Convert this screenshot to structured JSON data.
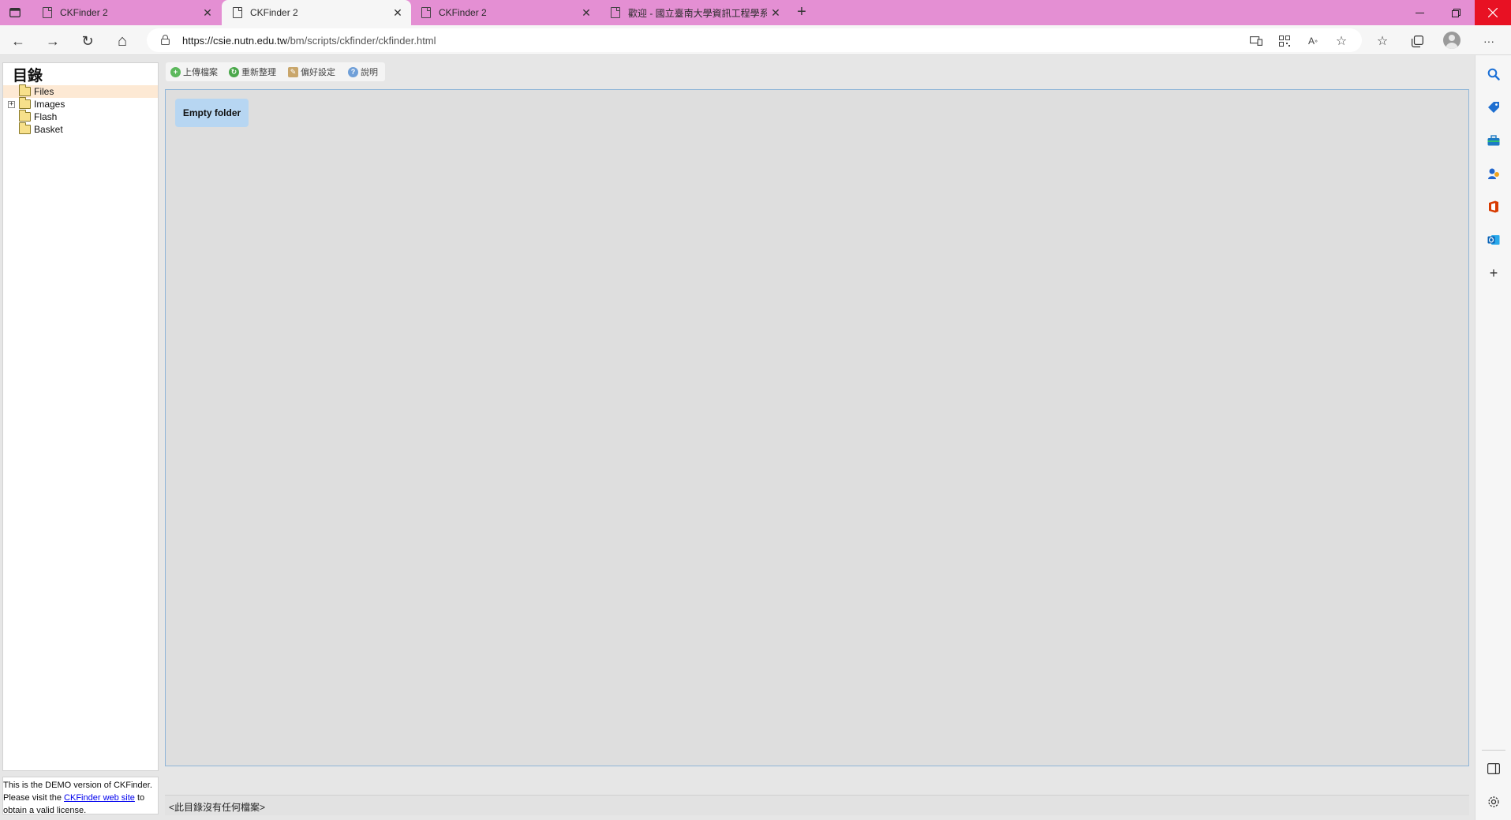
{
  "browser": {
    "tabs": [
      {
        "title": "CKFinder 2",
        "active": false
      },
      {
        "title": "CKFinder 2",
        "active": true
      },
      {
        "title": "CKFinder 2",
        "active": false
      },
      {
        "title": "歡迎 - 國立臺南大學資訊工程學系",
        "active": false
      }
    ],
    "new_tab_glyph": "+",
    "window_controls": {
      "minimize": "—",
      "restore": "❐",
      "close": "✕"
    },
    "url_host": "https://csie.nutn.edu.tw",
    "url_path": "/bm/scripts/ckfinder/ckfinder.html",
    "more_glyph": "···",
    "nav_glyphs": {
      "back": "←",
      "forward": "→",
      "reload": "↻",
      "home": "⌂"
    },
    "sidebar_icons": [
      "search-icon",
      "shopping-tag-icon",
      "toolbox-icon",
      "games-icon",
      "office-icon",
      "outlook-icon",
      "add-icon",
      "panel-icon",
      "settings-icon"
    ]
  },
  "ckfinder": {
    "folder_heading": "目錄",
    "folders": [
      {
        "label": "Files",
        "selected": true,
        "expandable": false
      },
      {
        "label": "Images",
        "selected": false,
        "expandable": true
      },
      {
        "label": "Flash",
        "selected": false,
        "expandable": false
      },
      {
        "label": "Basket",
        "selected": false,
        "expandable": false
      }
    ],
    "toolbar": {
      "upload": "上傳檔案",
      "refresh": "重新整理",
      "settings": "偏好設定",
      "help": "說明"
    },
    "empty_folder": "Empty folder",
    "status": "<此目錄沒有任何檔案>",
    "demo_notice": {
      "prefix": "This is the DEMO version of CKFinder. Please visit the ",
      "link": "CKFinder web site",
      "suffix": " to obtain a valid license."
    }
  }
}
